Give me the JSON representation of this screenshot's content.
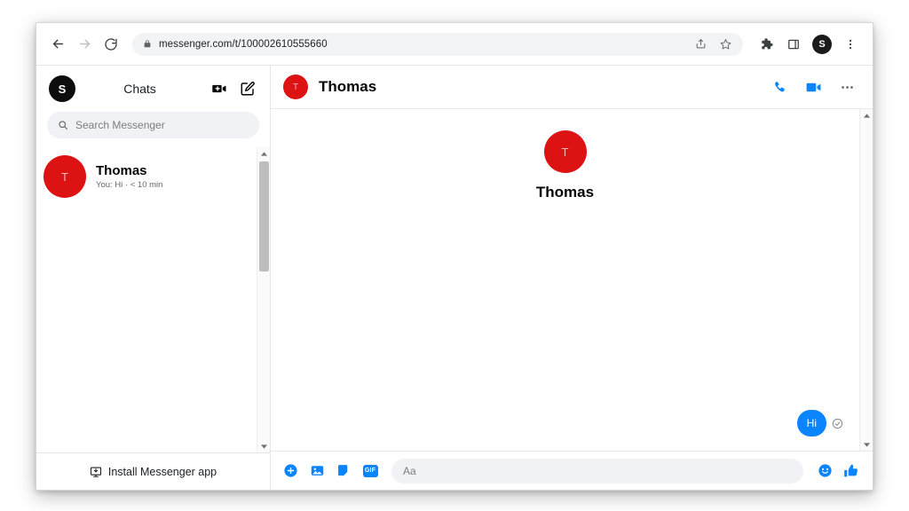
{
  "browser": {
    "url": "messenger.com/t/100002610555660",
    "back_label": "Back",
    "forward_label": "Forward",
    "reload_label": "Reload",
    "share_label": "Share this page",
    "bookmark_label": "Bookmark this tab",
    "extensions_label": "Extensions",
    "sidepanel_label": "Side panel",
    "profile_initial": "S",
    "menu_label": "Customize and control Google Chrome"
  },
  "sidebar": {
    "user_initial": "S",
    "title": "Chats",
    "new_video_call_label": "New video call",
    "new_message_label": "New message",
    "search": {
      "placeholder": "Search Messenger",
      "value": ""
    },
    "chats": [
      {
        "avatar_initial": "T",
        "name": "Thomas",
        "snippet": "You: Hi · < 10 min",
        "avatar_color": "#dd1212"
      }
    ],
    "install": {
      "label": "Install Messenger app",
      "icon": "install-monitor-icon"
    },
    "scrollbar": {
      "up_label": "Scroll up",
      "down_label": "Scroll down"
    }
  },
  "thread": {
    "avatar_initial": "T",
    "name": "Thomas",
    "avatar_color": "#dd1212",
    "actions": {
      "audio_call_label": "Start a voice call",
      "video_call_label": "Start a video call",
      "conversation_info_label": "Conversation information"
    },
    "profile": {
      "avatar_initial": "T",
      "name": "Thomas"
    },
    "messages": [
      {
        "text": "Hi",
        "outgoing": true,
        "status": "Sent",
        "bubble_color": "#0a84ff"
      }
    ]
  },
  "composer": {
    "add_files_label": "Open more actions",
    "photo_label": "Attach a file",
    "sticker_label": "Choose a sticker",
    "gif_label": "GIF",
    "gif_badge_text": "GIF",
    "input": {
      "placeholder": "Aa",
      "value": ""
    },
    "emoji_label": "Choose an emoji",
    "like_label": "Send a like"
  },
  "colors": {
    "accent": "#0a84ff",
    "avatar_red": "#dd1212",
    "panel_bg": "#ffffff",
    "field_bg": "#f0f2f5"
  }
}
